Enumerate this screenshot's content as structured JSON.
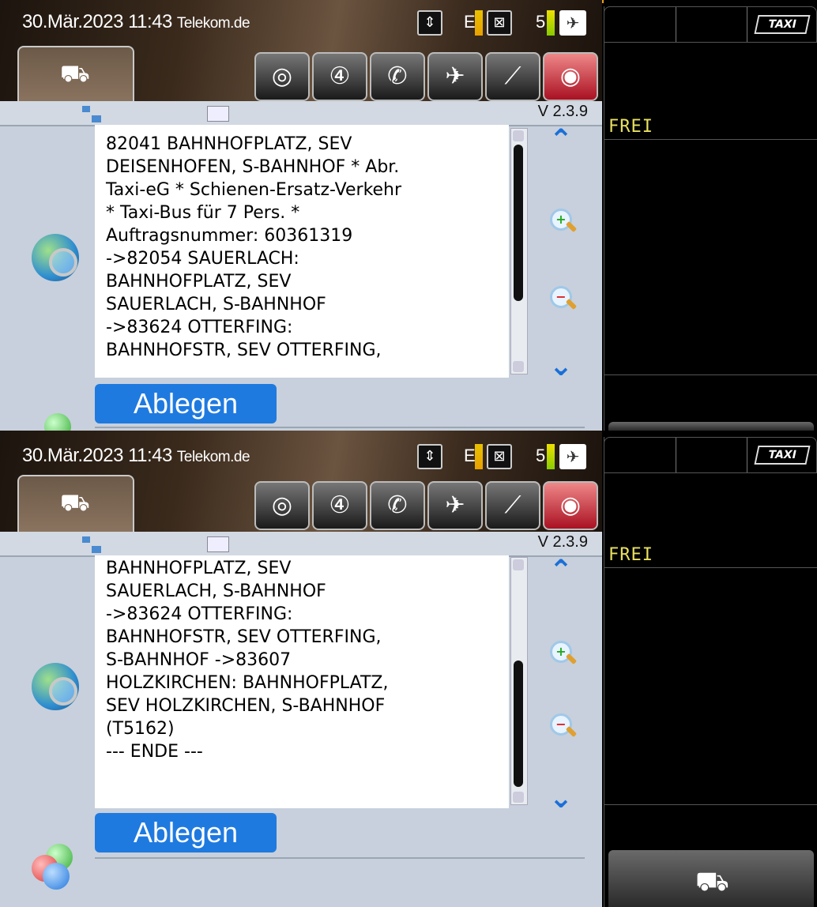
{
  "screens": [
    {
      "status": {
        "datetime": "30.Mär.2023 11:43",
        "carrier": "Telekom.de",
        "e_label": "E",
        "sat_count": "5"
      },
      "version": "V 2.3.9",
      "message": "82041 BAHNHOFPLATZ, SEV\nDEISENHOFEN, S-BAHNHOF * Abr.\nTaxi-eG * Schienen-Ersatz-Verkehr\n* Taxi-Bus für 7 Pers. *\nAuftragsnummer: 60361319\n->82054 SAUERLACH:\nBAHNHOFPLATZ, SEV\nSAUERLACH, S-BAHNHOF\n->83624 OTTERFING:\nBAHNHOFSTR, SEV OTTERFING,",
      "ablegen_label": "Ablegen",
      "right": {
        "taxi_label": "TAXI",
        "status_label": "FREI"
      }
    },
    {
      "status": {
        "datetime": "30.Mär.2023 11:43",
        "carrier": "Telekom.de",
        "e_label": "E",
        "sat_count": "5"
      },
      "version": "V 2.3.9",
      "message": "BAHNHOFPLATZ, SEV\nSAUERLACH, S-BAHNHOF\n->83624 OTTERFING:\nBAHNHOFSTR, SEV OTTERFING,\nS-BAHNHOF ->83607\nHOLZKIRCHEN: BAHNHOFPLATZ,\nSEV HOLZKIRCHEN, S-BAHNHOF\n(T5162)\n--- ENDE ---",
      "ablegen_label": "Ablegen",
      "right": {
        "taxi_label": "TAXI",
        "status_label": "FREI"
      }
    }
  ],
  "toolbar_icons": [
    "clock-icon",
    "radio-icon",
    "phone-icon",
    "satellite-icon",
    "screwdriver-icon",
    "driver-icon"
  ],
  "colors": {
    "accent_blue": "#1f7ae0",
    "frei_yellow": "#e8e060",
    "content_bg": "#c7d0dc"
  }
}
